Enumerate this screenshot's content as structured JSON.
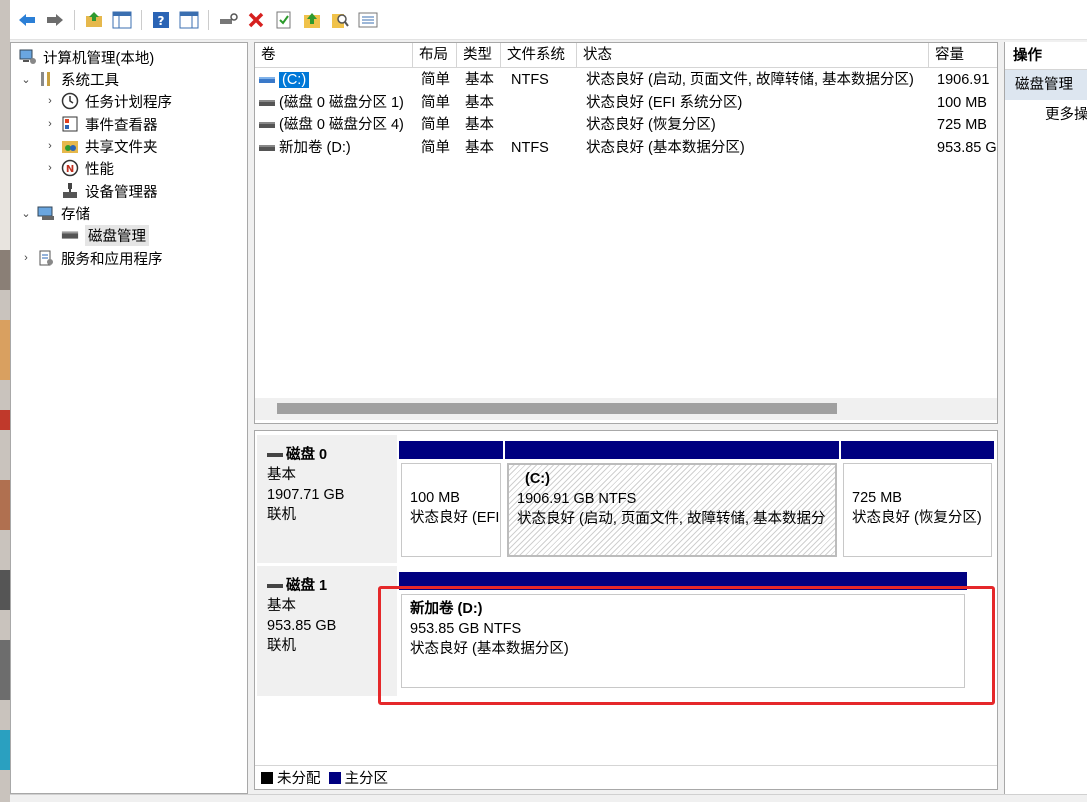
{
  "toolbar": {
    "icons": [
      "back-icon",
      "forward-icon",
      "up-folder-icon",
      "show-hide-tree-icon",
      "help-icon",
      "show-hide-action-icon",
      "connect-drive-icon",
      "delete-icon",
      "properties-icon",
      "folder-up-icon",
      "search-icon",
      "list-view-icon"
    ]
  },
  "tree": {
    "root": "计算机管理(本地)",
    "system_tools": "系统工具",
    "task_scheduler": "任务计划程序",
    "event_viewer": "事件查看器",
    "shared_folders": "共享文件夹",
    "performance": "性能",
    "device_manager": "设备管理器",
    "storage": "存储",
    "disk_management": "磁盘管理",
    "services_apps": "服务和应用程序"
  },
  "volumes": {
    "headers": [
      "卷",
      "布局",
      "类型",
      "文件系统",
      "状态",
      "容量"
    ],
    "rows": [
      {
        "name": "(C:)",
        "layout": "简单",
        "type": "基本",
        "fs": "NTFS",
        "status": "状态良好 (启动, 页面文件, 故障转储, 基本数据分区)",
        "capacity": "1906.91"
      },
      {
        "name": "(磁盘 0 磁盘分区 1)",
        "layout": "简单",
        "type": "基本",
        "fs": "",
        "status": "状态良好 (EFI 系统分区)",
        "capacity": "100 MB"
      },
      {
        "name": "(磁盘 0 磁盘分区 4)",
        "layout": "简单",
        "type": "基本",
        "fs": "",
        "status": "状态良好 (恢复分区)",
        "capacity": "725 MB"
      },
      {
        "name": "新加卷 (D:)",
        "layout": "简单",
        "type": "基本",
        "fs": "NTFS",
        "status": "状态良好 (基本数据分区)",
        "capacity": "953.85 G"
      }
    ]
  },
  "disks": {
    "disk0": {
      "name": "磁盘 0",
      "type": "基本",
      "size": "1907.71 GB",
      "state": "联机",
      "p1": {
        "size": "100 MB",
        "status": "状态良好 (EFI"
      },
      "p2": {
        "name": "(C:)",
        "size": "1906.91 GB NTFS",
        "status": "状态良好 (启动, 页面文件, 故障转储, 基本数据分"
      },
      "p3": {
        "size": "725 MB",
        "status": "状态良好 (恢复分区)"
      }
    },
    "disk1": {
      "name": "磁盘 1",
      "type": "基本",
      "size": "953.85 GB",
      "state": "联机",
      "p1": {
        "name": "新加卷 (D:)",
        "size": "953.85 GB NTFS",
        "status": "状态良好 (基本数据分区)"
      }
    }
  },
  "legend": {
    "unallocated": "未分配",
    "primary": "主分区",
    "unallocated_color": "#000000",
    "primary_color": "#000080"
  },
  "actions": {
    "title": "操作",
    "item": "磁盘管理",
    "more": "更多操"
  },
  "colors": {
    "highlight": "#e5282a",
    "partition_bar": "#000080",
    "selection": "#0078d7"
  }
}
